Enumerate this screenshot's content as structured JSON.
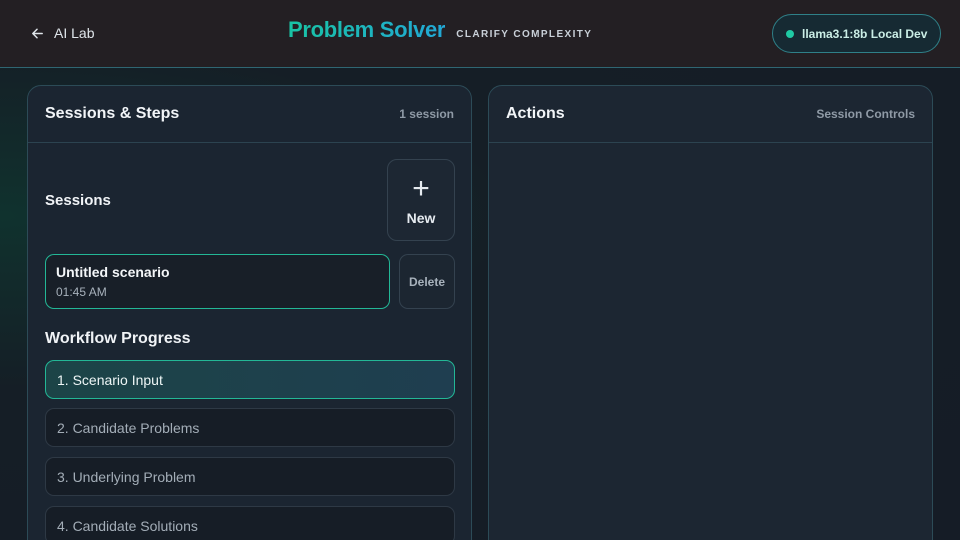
{
  "header": {
    "back_label": "AI Lab",
    "title": "Problem Solver",
    "tagline": "CLARIFY COMPLEXITY",
    "model_label": "llama3.1:8b Local Dev",
    "colors": {
      "accent_teal": "#1fcaa4",
      "accent_blue": "#22a8d6"
    }
  },
  "left_panel": {
    "title": "Sessions & Steps",
    "meta": "1 session",
    "sessions_heading": "Sessions",
    "new_button": {
      "icon": "plus-icon",
      "label": "New"
    },
    "sessions": [
      {
        "name": "Untitled scenario",
        "time": "01:45 AM"
      }
    ],
    "delete_label": "Delete",
    "workflow_heading": "Workflow Progress",
    "steps": [
      {
        "label": "1. Scenario Input",
        "active": true
      },
      {
        "label": "2. Candidate Problems",
        "active": false
      },
      {
        "label": "3. Underlying Problem",
        "active": false
      },
      {
        "label": "4. Candidate Solutions",
        "active": false
      }
    ]
  },
  "right_panel": {
    "title": "Actions",
    "meta": "Session Controls"
  }
}
